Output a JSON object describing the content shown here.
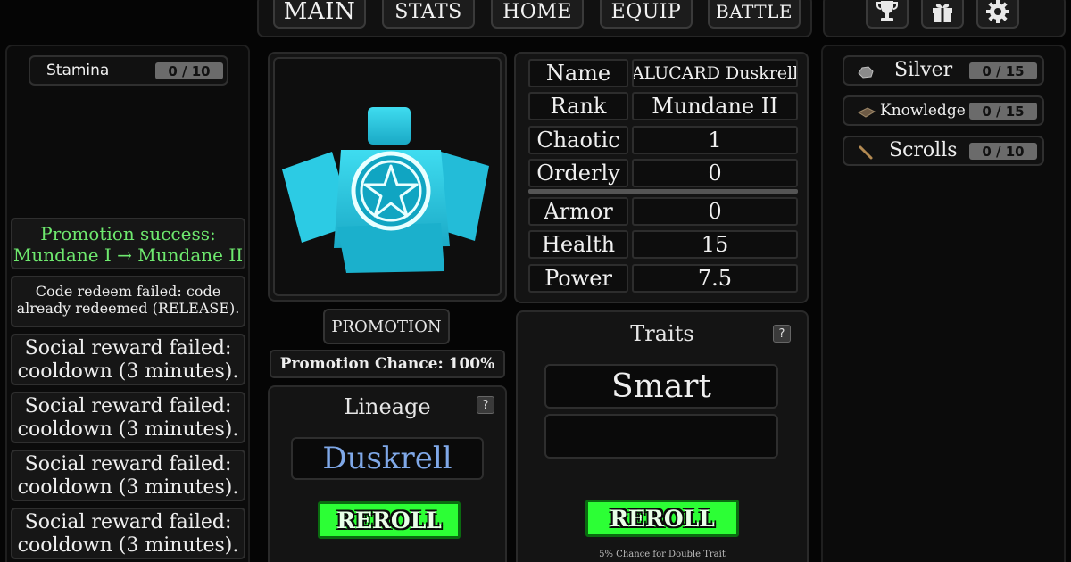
{
  "nav": {
    "items": [
      "MAIN",
      "STATS",
      "HOME",
      "EQUIP",
      "BATTLE"
    ],
    "icons": [
      "trophy-icon",
      "gift-icon",
      "gear-icon"
    ]
  },
  "left": {
    "stamina": {
      "label": "Stamina",
      "value": "0 / 10"
    },
    "messages": {
      "promotion": [
        "Promotion success:",
        "Mundane I → Mundane II"
      ],
      "code": [
        "Code redeem failed: code",
        "already redeemed (RELEASE)."
      ],
      "social": [
        [
          "Social reward failed:",
          "cooldown (3 minutes)."
        ],
        [
          "Social reward failed:",
          "cooldown (3 minutes)."
        ],
        [
          "Social reward failed:",
          "cooldown (3 minutes)."
        ],
        [
          "Social reward failed:",
          "cooldown (3 minutes)."
        ]
      ]
    }
  },
  "character": {
    "promotion_button": "PROMOTION",
    "promotion_chance": "Promotion Chance: 100%"
  },
  "stats": {
    "rows": [
      {
        "label": "Name",
        "value": "ALUCARD Duskrell"
      },
      {
        "label": "Rank",
        "value": "Mundane II"
      },
      {
        "label": "Chaotic",
        "value": "1"
      },
      {
        "label": "Orderly",
        "value": "0"
      },
      {
        "label": "Armor",
        "value": "0"
      },
      {
        "label": "Health",
        "value": "15"
      },
      {
        "label": "Power",
        "value": "7.5"
      }
    ]
  },
  "lineage": {
    "title": "Lineage",
    "help": "?",
    "value": "Duskrell",
    "reroll": "REROLL",
    "value_color": "#7fa8e8"
  },
  "traits": {
    "title": "Traits",
    "help": "?",
    "slot1": "Smart",
    "slot2": "",
    "reroll": "REROLL",
    "note": "5% Chance for Double Trait"
  },
  "resources": [
    {
      "label": "Silver",
      "value": "0 / 15",
      "icon": "silver-ore-icon"
    },
    {
      "label": "Knowledge",
      "value": "0 / 15",
      "icon": "book-icon"
    },
    {
      "label": "Scrolls",
      "value": "0 / 10",
      "icon": "quill-icon"
    }
  ],
  "colors": {
    "accent_green": "#2cff35",
    "message_green": "#6ee86e",
    "character_cyan": "#22c9e0"
  }
}
